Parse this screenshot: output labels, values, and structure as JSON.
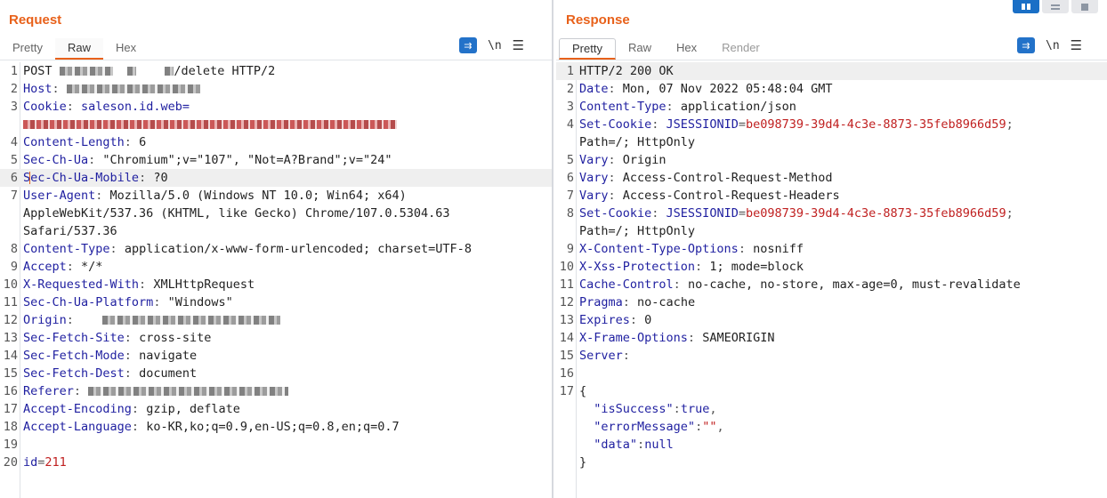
{
  "layout_buttons": [
    "split-horizontal-icon",
    "split-vertical-icon",
    "single-pane-icon"
  ],
  "request": {
    "title": "Request",
    "tabs": [
      "Pretty",
      "Raw",
      "Hex"
    ],
    "active_tab": "Raw",
    "tools": {
      "wrap": "wrap-icon",
      "newline": "\\n",
      "menu": "☰"
    },
    "lines": [
      {
        "n": "1",
        "segs": [
          {
            "t": "POST "
          },
          {
            "blur": 60
          },
          {
            "t": "  "
          },
          {
            "blur": 10
          },
          {
            "t": "    "
          },
          {
            "blur": 10
          },
          {
            "t": "/delete HTTP/2"
          }
        ]
      },
      {
        "n": "2",
        "segs": [
          {
            "t": "Host",
            "c": "k"
          },
          {
            "t": ": ",
            "c": "c"
          },
          {
            "blur": 150
          }
        ]
      },
      {
        "n": "3",
        "segs": [
          {
            "t": "Cookie",
            "c": "k"
          },
          {
            "t": ": ",
            "c": "c"
          },
          {
            "t": "saleson.id.web=",
            "c": "k"
          }
        ]
      },
      {
        "n": "",
        "segs": [
          {
            "blur": 420,
            "red": true
          }
        ]
      },
      {
        "n": "4",
        "segs": [
          {
            "t": "Content-Length",
            "c": "k"
          },
          {
            "t": ": ",
            "c": "c"
          },
          {
            "t": "6"
          }
        ]
      },
      {
        "n": "5",
        "segs": [
          {
            "t": "Sec-Ch-Ua",
            "c": "k"
          },
          {
            "t": ": ",
            "c": "c"
          },
          {
            "t": "\"Chromium\";v=\"107\", \"Not=A?Brand\";v=\"24\""
          }
        ]
      },
      {
        "n": "6",
        "hl": true,
        "segs": [
          {
            "t": "S",
            "c": "k"
          },
          {
            "caret": true
          },
          {
            "t": "ec-Ch-Ua-Mobile",
            "c": "k"
          },
          {
            "t": ": ",
            "c": "c"
          },
          {
            "t": "?0"
          }
        ]
      },
      {
        "n": "7",
        "segs": [
          {
            "t": "User-Agent",
            "c": "k"
          },
          {
            "t": ": ",
            "c": "c"
          },
          {
            "t": "Mozilla/5.0 (Windows NT 10.0; Win64; x64)"
          }
        ]
      },
      {
        "n": "",
        "segs": [
          {
            "t": "AppleWebKit/537.36 (KHTML, like Gecko) Chrome/107.0.5304.63"
          }
        ]
      },
      {
        "n": "",
        "segs": [
          {
            "t": "Safari/537.36"
          }
        ]
      },
      {
        "n": "8",
        "segs": [
          {
            "t": "Content-Type",
            "c": "k"
          },
          {
            "t": ": ",
            "c": "c"
          },
          {
            "t": "application/x-www-form-urlencoded; charset=UTF-8"
          }
        ]
      },
      {
        "n": "9",
        "segs": [
          {
            "t": "Accept",
            "c": "k"
          },
          {
            "t": ": ",
            "c": "c"
          },
          {
            "t": "*/*"
          }
        ]
      },
      {
        "n": "10",
        "segs": [
          {
            "t": "X-Requested-With",
            "c": "k"
          },
          {
            "t": ": ",
            "c": "c"
          },
          {
            "t": "XMLHttpRequest"
          }
        ]
      },
      {
        "n": "11",
        "segs": [
          {
            "t": "Sec-Ch-Ua-Platform",
            "c": "k"
          },
          {
            "t": ": ",
            "c": "c"
          },
          {
            "t": "\"Windows\""
          }
        ]
      },
      {
        "n": "12",
        "segs": [
          {
            "t": "Origin",
            "c": "k"
          },
          {
            "t": ":    ",
            "c": "c"
          },
          {
            "blur": 200
          }
        ]
      },
      {
        "n": "13",
        "segs": [
          {
            "t": "Sec-Fetch-Site",
            "c": "k"
          },
          {
            "t": ": ",
            "c": "c"
          },
          {
            "t": "cross-site"
          }
        ]
      },
      {
        "n": "14",
        "segs": [
          {
            "t": "Sec-Fetch-Mode",
            "c": "k"
          },
          {
            "t": ": ",
            "c": "c"
          },
          {
            "t": "navigate"
          }
        ]
      },
      {
        "n": "15",
        "segs": [
          {
            "t": "Sec-Fetch-Dest",
            "c": "k"
          },
          {
            "t": ": ",
            "c": "c"
          },
          {
            "t": "document"
          }
        ]
      },
      {
        "n": "16",
        "segs": [
          {
            "t": "Referer",
            "c": "k"
          },
          {
            "t": ": ",
            "c": "c"
          },
          {
            "blur": 225
          }
        ]
      },
      {
        "n": "17",
        "segs": [
          {
            "t": "Accept-Encoding",
            "c": "k"
          },
          {
            "t": ": ",
            "c": "c"
          },
          {
            "t": "gzip, deflate"
          }
        ]
      },
      {
        "n": "18",
        "segs": [
          {
            "t": "Accept-Language",
            "c": "k"
          },
          {
            "t": ": ",
            "c": "c"
          },
          {
            "t": "ko-KR,ko;q=0.9,en-US;q=0.8,en;q=0.7"
          }
        ]
      },
      {
        "n": "19",
        "segs": []
      },
      {
        "n": "20",
        "segs": [
          {
            "t": "id",
            "c": "k"
          },
          {
            "t": "=",
            "c": "c"
          },
          {
            "t": "211",
            "c": "s"
          }
        ]
      }
    ]
  },
  "response": {
    "title": "Response",
    "tabs": [
      "Pretty",
      "Raw",
      "Hex",
      "Render"
    ],
    "active_tab": "Pretty",
    "tools": {
      "wrap": "wrap-icon",
      "newline": "\\n",
      "menu": "☰"
    },
    "lines": [
      {
        "n": "1",
        "hl": true,
        "segs": [
          {
            "t": "HTTP/2 200 OK"
          }
        ]
      },
      {
        "n": "2",
        "segs": [
          {
            "t": "Date",
            "c": "k"
          },
          {
            "t": ": ",
            "c": "c"
          },
          {
            "t": "Mon, 07 Nov 2022 05:48:04 GMT"
          }
        ]
      },
      {
        "n": "3",
        "segs": [
          {
            "t": "Content-Type",
            "c": "k"
          },
          {
            "t": ": ",
            "c": "c"
          },
          {
            "t": "application/json"
          }
        ]
      },
      {
        "n": "4",
        "segs": [
          {
            "t": "Set-Cookie",
            "c": "k"
          },
          {
            "t": ": ",
            "c": "c"
          },
          {
            "t": "JSESSIONID",
            "c": "k"
          },
          {
            "t": "=",
            "c": "c"
          },
          {
            "t": "be098739-39d4-4c3e-8873-35feb8966d59",
            "c": "s"
          },
          {
            "t": ";",
            "c": "c"
          }
        ]
      },
      {
        "n": "",
        "segs": [
          {
            "t": "Path=/; HttpOnly"
          }
        ]
      },
      {
        "n": "5",
        "segs": [
          {
            "t": "Vary",
            "c": "k"
          },
          {
            "t": ": ",
            "c": "c"
          },
          {
            "t": "Origin"
          }
        ]
      },
      {
        "n": "6",
        "segs": [
          {
            "t": "Vary",
            "c": "k"
          },
          {
            "t": ": ",
            "c": "c"
          },
          {
            "t": "Access-Control-Request-Method"
          }
        ]
      },
      {
        "n": "7",
        "segs": [
          {
            "t": "Vary",
            "c": "k"
          },
          {
            "t": ": ",
            "c": "c"
          },
          {
            "t": "Access-Control-Request-Headers"
          }
        ]
      },
      {
        "n": "8",
        "segs": [
          {
            "t": "Set-Cookie",
            "c": "k"
          },
          {
            "t": ": ",
            "c": "c"
          },
          {
            "t": "JSESSIONID",
            "c": "k"
          },
          {
            "t": "=",
            "c": "c"
          },
          {
            "t": "be098739-39d4-4c3e-8873-35feb8966d59",
            "c": "s"
          },
          {
            "t": ";",
            "c": "c"
          }
        ]
      },
      {
        "n": "",
        "segs": [
          {
            "t": "Path=/; HttpOnly"
          }
        ]
      },
      {
        "n": "9",
        "segs": [
          {
            "t": "X-Content-Type-Options",
            "c": "k"
          },
          {
            "t": ": ",
            "c": "c"
          },
          {
            "t": "nosniff"
          }
        ]
      },
      {
        "n": "10",
        "segs": [
          {
            "t": "X-Xss-Protection",
            "c": "k"
          },
          {
            "t": ": ",
            "c": "c"
          },
          {
            "t": "1; mode=block"
          }
        ]
      },
      {
        "n": "11",
        "segs": [
          {
            "t": "Cache-Control",
            "c": "k"
          },
          {
            "t": ": ",
            "c": "c"
          },
          {
            "t": "no-cache, no-store, max-age=0, must-revalidate"
          }
        ]
      },
      {
        "n": "12",
        "segs": [
          {
            "t": "Pragma",
            "c": "k"
          },
          {
            "t": ": ",
            "c": "c"
          },
          {
            "t": "no-cache"
          }
        ]
      },
      {
        "n": "13",
        "segs": [
          {
            "t": "Expires",
            "c": "k"
          },
          {
            "t": ": ",
            "c": "c"
          },
          {
            "t": "0"
          }
        ]
      },
      {
        "n": "14",
        "segs": [
          {
            "t": "X-Frame-Options",
            "c": "k"
          },
          {
            "t": ": ",
            "c": "c"
          },
          {
            "t": "SAMEORIGIN"
          }
        ]
      },
      {
        "n": "15",
        "segs": [
          {
            "t": "Server",
            "c": "k"
          },
          {
            "t": ":",
            "c": "c"
          }
        ]
      },
      {
        "n": "16",
        "segs": []
      },
      {
        "n": "17",
        "segs": [
          {
            "t": "{"
          }
        ]
      },
      {
        "n": "",
        "segs": [
          {
            "t": "  "
          },
          {
            "t": "\"isSuccess\"",
            "c": "k"
          },
          {
            "t": ":",
            "c": "c"
          },
          {
            "t": "true",
            "c": "k"
          },
          {
            "t": ",",
            "c": "c"
          }
        ]
      },
      {
        "n": "",
        "segs": [
          {
            "t": "  "
          },
          {
            "t": "\"errorMessage\"",
            "c": "k"
          },
          {
            "t": ":",
            "c": "c"
          },
          {
            "t": "\"\"",
            "c": "s"
          },
          {
            "t": ",",
            "c": "c"
          }
        ]
      },
      {
        "n": "",
        "segs": [
          {
            "t": "  "
          },
          {
            "t": "\"data\"",
            "c": "k"
          },
          {
            "t": ":",
            "c": "c"
          },
          {
            "t": "null",
            "c": "k"
          }
        ]
      },
      {
        "n": "",
        "segs": [
          {
            "t": "}"
          }
        ]
      }
    ]
  }
}
